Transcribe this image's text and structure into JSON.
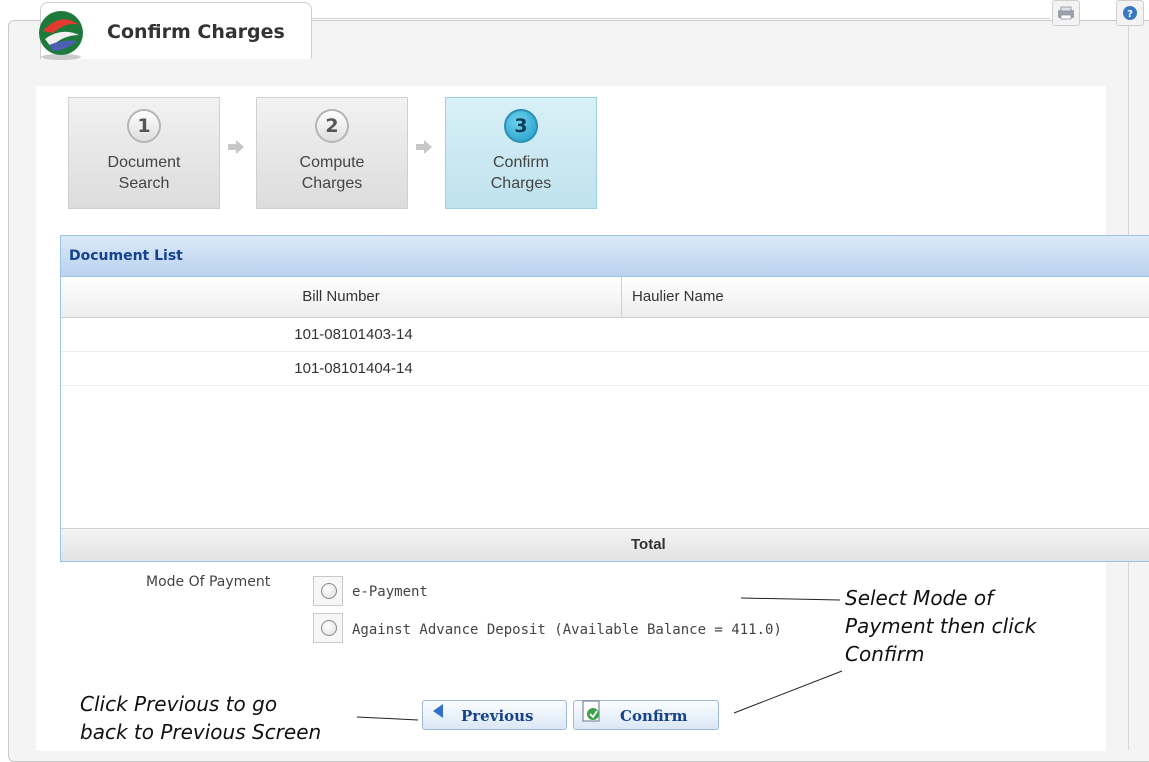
{
  "page": {
    "title": "Confirm Charges"
  },
  "top_icons": {
    "print": "print-icon",
    "help": "help-icon"
  },
  "wizard": {
    "steps": [
      {
        "number": "1",
        "label": "Document\nSearch",
        "active": false
      },
      {
        "number": "2",
        "label": "Compute\nCharges",
        "active": false
      },
      {
        "number": "3",
        "label": "Confirm\nCharges",
        "active": true
      }
    ]
  },
  "document_list": {
    "title": "Document List",
    "columns": [
      "Bill Number",
      "Haulier Name"
    ],
    "rows": [
      {
        "bill_number": "101-08101403-14",
        "haulier_name": ""
      },
      {
        "bill_number": "101-08101404-14",
        "haulier_name": ""
      }
    ],
    "total_label": "Total"
  },
  "payment": {
    "label": "Mode Of Payment",
    "options": [
      {
        "text": "e-Payment",
        "selected": false
      },
      {
        "text": "Against Advance Deposit (Available Balance = 411.0)",
        "selected": false
      }
    ]
  },
  "buttons": {
    "previous": "Previous",
    "confirm": "Confirm"
  },
  "annotations": {
    "left": "Click Previous to go\nback to Previous Screen",
    "right": "Select Mode of\nPayment then click\nConfirm"
  },
  "colors": {
    "accent": "#15428b",
    "active_step": "#bfe2ee",
    "grid_header": "#b9d2ef"
  }
}
